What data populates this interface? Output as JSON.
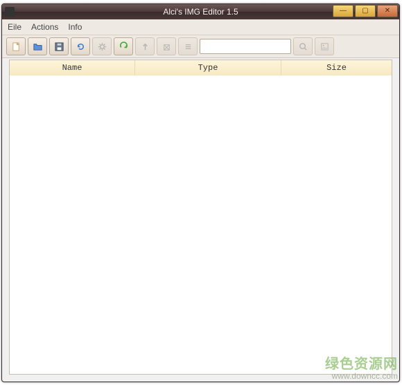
{
  "title": "Alci's IMG Editor 1.5",
  "menu": {
    "file": "Eile",
    "actions": "Actions",
    "info": "Info"
  },
  "toolbar": {
    "new": "New",
    "open": "Open",
    "save": "Save",
    "refresh": "Refresh",
    "settings": "Settings",
    "import": "Import",
    "export": "Export",
    "delete": "Delete",
    "list": "List",
    "search_placeholder": "",
    "search_go": "Search",
    "preview": "Preview"
  },
  "columns": {
    "name": "Name",
    "type": "Type",
    "size": "Size"
  },
  "rows": [],
  "watermark": {
    "line1": "绿色资源网",
    "line2": "www.downcc.com"
  },
  "win": {
    "min": "—",
    "max": "▢",
    "close": "✕"
  }
}
